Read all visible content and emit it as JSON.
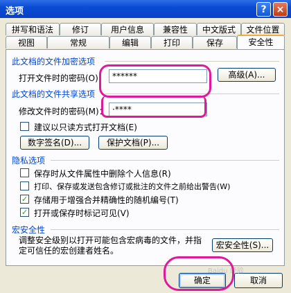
{
  "dialog": {
    "title": "选项",
    "help_glyph": "?",
    "close_glyph": "×"
  },
  "tabs_row1": [
    {
      "label": "拼写和语法"
    },
    {
      "label": "修订"
    },
    {
      "label": "用户信息"
    },
    {
      "label": "兼容性"
    },
    {
      "label": "中文版式"
    },
    {
      "label": "文件位置"
    }
  ],
  "tabs_row2": [
    {
      "label": "视图"
    },
    {
      "label": "常规"
    },
    {
      "label": "编辑"
    },
    {
      "label": "打印"
    },
    {
      "label": "保存"
    },
    {
      "label": "安全性"
    }
  ],
  "active_tab": "安全性",
  "encrypt_section": {
    "title": "此文档的文件加密选项",
    "open_password_label": "打开文件时的密码(O)：",
    "open_password_value": "******",
    "advanced_button": "高级(A)..."
  },
  "share_section": {
    "title": "此文档的文件共享选项",
    "modify_password_label": "修改文件时的密码(M)：",
    "modify_password_value": "·****",
    "readonly_checkbox": {
      "label": "建议以只读方式打开文档(E)",
      "checked": false
    },
    "digital_sign_button": "数字签名(D)...",
    "protect_doc_button": "保护文档(P)..."
  },
  "privacy_section": {
    "title": "隐私选项",
    "options": [
      {
        "label": "保存时从文件属性中删除个人信息(R)",
        "checked": false
      },
      {
        "label": "打印、保存或发送包含修订或批注的文件之前给出警告(W)",
        "checked": false
      },
      {
        "label": "存储用于增强合并精确性的随机编号(T)",
        "checked": true
      },
      {
        "label": "打开或保存时标记可见(V)",
        "checked": true
      }
    ]
  },
  "macro_section": {
    "title": "宏安全性",
    "description": "调整安全级别以打开可能包含宏病毒的文件，并指定可信任的宏创建者姓名。",
    "macro_button": "宏安全性(S)..."
  },
  "footer": {
    "ok_button": "确定",
    "cancel_button": "取消"
  },
  "watermark": "Baidu 经验",
  "colors": {
    "titlebar": "#0a4bd3",
    "highlight": "#e0199b",
    "group_title": "#0046d5"
  }
}
